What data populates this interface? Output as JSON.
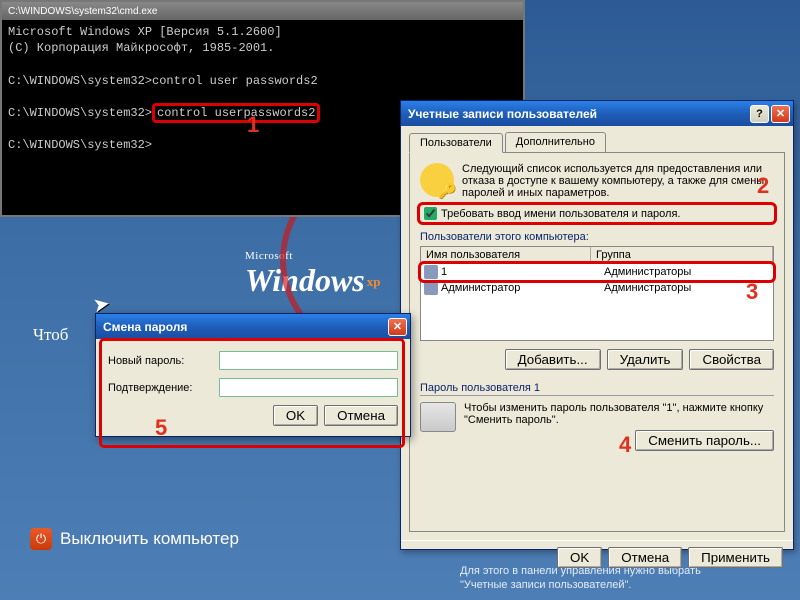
{
  "desktop": {
    "logo_small": "Microsoft",
    "logo_main": "Windows",
    "logo_xp": "xp",
    "hint": "Чтоб",
    "shutdown": "Выключить компьютер",
    "footer1": "Для этого в панели управления нужно выбрать",
    "footer2": "\"Учетные записи пользователей\"."
  },
  "cmd": {
    "title": "C:\\WINDOWS\\system32\\cmd.exe",
    "line1": "Microsoft Windows XP [Версия 5.1.2600]",
    "line2": "(C) Корпорация Майкрософт, 1985-2001.",
    "line3": "C:\\WINDOWS\\system32>control user passwords2",
    "line4a": "C:\\WINDOWS\\system32>",
    "line4b": "control userpasswords2",
    "line5": "C:\\WINDOWS\\system32>",
    "annot": "1"
  },
  "ua": {
    "title": "Учетные записи пользователей",
    "tabs": {
      "users": "Пользователи",
      "advanced": "Дополнительно"
    },
    "infoText": "Следующий список используется для предоставления или отказа в доступе к вашему компьютеру, а также для смены паролей и иных параметров.",
    "requireCredentials": {
      "checked": true,
      "label": "Требовать ввод имени пользователя и пароля."
    },
    "usersLabel": "Пользователи этого компьютера:",
    "columns": {
      "name": "Имя пользователя",
      "group": "Группа"
    },
    "rows": [
      {
        "name": "1",
        "group": "Администраторы"
      },
      {
        "name": "Администратор",
        "group": "Администраторы"
      }
    ],
    "buttons": {
      "add": "Добавить...",
      "remove": "Удалить",
      "props": "Свойства"
    },
    "pwdSection": "Пароль пользователя 1",
    "pwdHelp": "Чтобы изменить пароль пользователя \"1\", нажмите кнопку \"Сменить пароль\".",
    "changePwd": "Сменить пароль...",
    "ok": "OK",
    "cancel": "Отмена",
    "apply": "Применить",
    "annots": {
      "a2": "2",
      "a3": "3",
      "a4": "4"
    }
  },
  "pw": {
    "title": "Смена пароля",
    "newpw": "Новый пароль:",
    "confirm": "Подтверждение:",
    "ok": "OK",
    "cancel": "Отмена",
    "annot": "5"
  }
}
